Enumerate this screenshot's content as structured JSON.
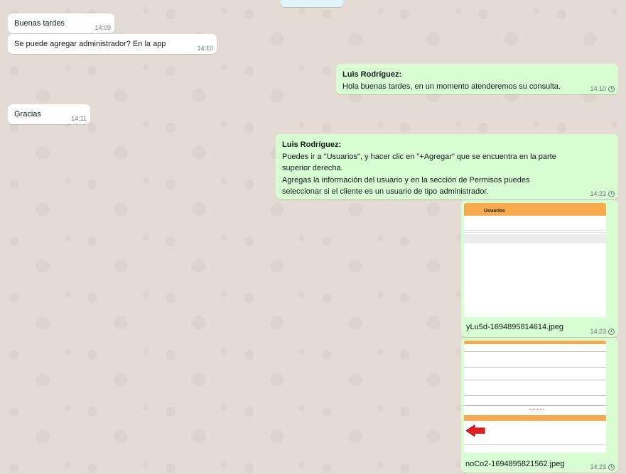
{
  "messages": {
    "m1": {
      "text": "Buenas tardes",
      "time": "14:09"
    },
    "m2": {
      "text": "Se puede agregar administrador? En la app",
      "time": "14:10"
    },
    "m3": {
      "sender": "Luis Rodríguez:",
      "text": "Hola buenas tardes, en un momento atenderemos su consulta.",
      "time": "14:10"
    },
    "m4": {
      "text": "Gracias",
      "time": "14:11"
    },
    "m5": {
      "sender": "Luis Rodríguez:",
      "lines": [
        "Puedes ir a \"Usuarios\", y hacer clic en \"+Agregar\" que se encuentra en la parte",
        "superior derecha.",
        "Agregas la información del usuario y en la sección de Permisos puedes",
        "seleccionar si el cliente es un usuario de tipo administrador."
      ],
      "time": "14:23"
    },
    "m6": {
      "image_title": "Usuarios",
      "filename": "yLu5d-1694895814614.jpeg",
      "time": "14:23"
    },
    "m7": {
      "filename": "noCo2-1694895821562.jpeg",
      "time": "14:23"
    }
  },
  "colors": {
    "incoming_bubble": "#ffffff",
    "outgoing_bubble": "#d9fdd3",
    "chat_background": "#e3dbd4",
    "thumbnail_orange": "#f7ab4c",
    "arrow_red": "#e02020"
  },
  "icons": {
    "pending_status": "clock-icon",
    "thumbnail_marker": "red-arrow-left-icon"
  }
}
